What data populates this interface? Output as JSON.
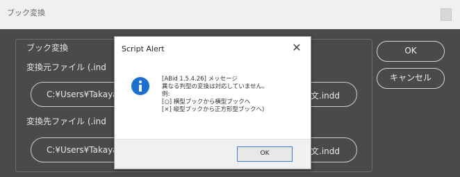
{
  "window": {
    "title": "ブック変換"
  },
  "group": {
    "label": "ブック変換"
  },
  "source": {
    "label": "変換元ファイル (.ind",
    "path_left": "C:¥Users¥Takaya",
    "path_right": "本文.indd"
  },
  "dest": {
    "label": "変換先ファイル (.ind",
    "path_left": "C:¥Users¥Takaya",
    "path_right": "本文.indd"
  },
  "buttons": {
    "ok": "OK",
    "cancel": "キャンセル"
  },
  "alert": {
    "title": "Script Alert",
    "close_glyph": "✕",
    "lines": [
      "[ABid 1.5.4.26] メッセージ",
      "異なる判型の変換は対応していません。",
      "例:",
      "[○] 横型ブックから横型ブックへ",
      "[×] 縦型ブックから正方形型ブックへ)"
    ],
    "ok_label": "OK"
  },
  "colors": {
    "dialog_bg": "#4a4a4a",
    "accent": "#3c7bd6",
    "info_icon": "#1a6fd1"
  }
}
